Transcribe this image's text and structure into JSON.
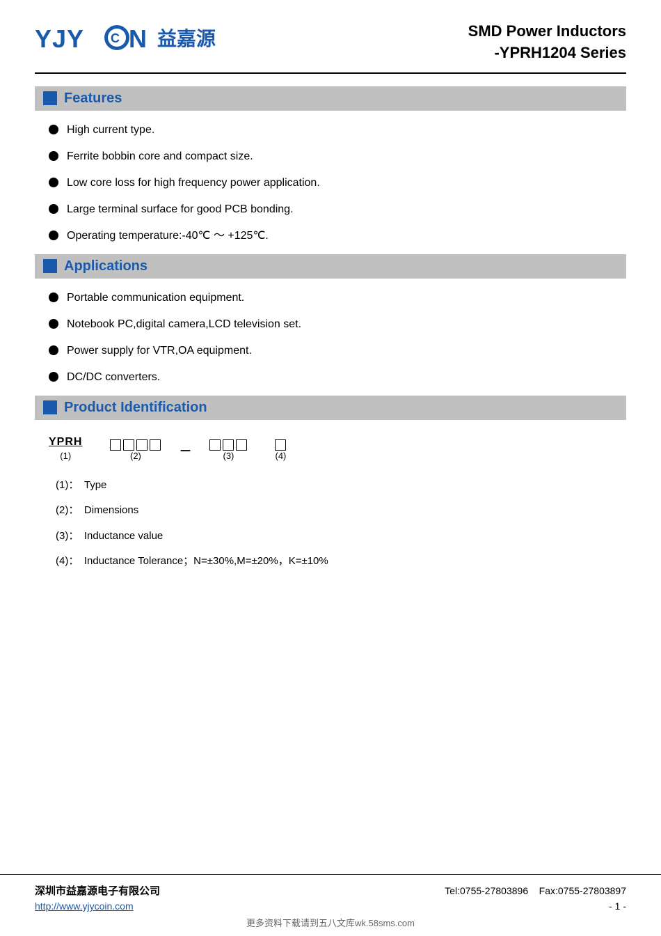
{
  "header": {
    "logo_text": "YJYCOIN",
    "logo_chinese": "益嘉源",
    "title_line1": "SMD Power Inductors",
    "title_line2": "-YPRH1204 Series"
  },
  "sections": {
    "features": {
      "label": "Features",
      "items": [
        "High current type.",
        "Ferrite bobbin core and compact size.",
        "Low core loss for high frequency power application.",
        "Large terminal surface for good PCB bonding.",
        "Operating temperature:-40℃ ～ +125℃."
      ]
    },
    "applications": {
      "label": "Applications",
      "items": [
        "Portable communication equipment.",
        "Notebook PC,digital camera,LCD television set.",
        "Power supply for VTR,OA equipment.",
        "DC/DC converters."
      ]
    },
    "product_identification": {
      "label": "Product Identification",
      "prefix": "YPRH",
      "prefix_num": "(1)",
      "boxes2": 4,
      "boxes3": 3,
      "box4": 1,
      "num2": "(2)",
      "num3": "(3)",
      "num4": "(4)",
      "details": [
        {
          "num": "(1)",
          "desc": "Type"
        },
        {
          "num": "(2)",
          "desc": "Dimensions"
        },
        {
          "num": "(3)",
          "desc": "Inductance value"
        },
        {
          "num": "(4)",
          "desc": "Inductance Tolerance；N=±30%,M=±20%，K=±10%"
        }
      ]
    }
  },
  "footer": {
    "company": "深圳市益嘉源电子有限公司",
    "tel": "Tel:0755-27803896",
    "fax": "Fax:0755-27803897",
    "website": "http://www.yjycoin.com",
    "page": "- 1 -",
    "watermark": "更多资料下载请到五八文库wk.58sms.com"
  }
}
